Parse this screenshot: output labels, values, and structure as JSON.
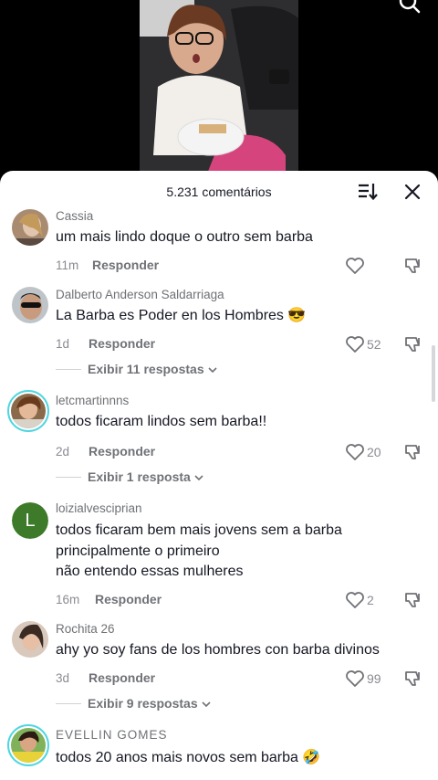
{
  "colors": {
    "accent_ring": "#4fd6e0",
    "text_primary": "#161823",
    "text_secondary": "#707277"
  },
  "video": {
    "icons": {
      "search": "search-icon"
    }
  },
  "header": {
    "count_label": "5.231 comentários",
    "icons": {
      "sort": "sort-icon",
      "close": "close-icon"
    }
  },
  "labels": {
    "reply": "Responder"
  },
  "comments": [
    {
      "username": "Cassia",
      "text": [
        "um mais lindo doque o outro sem barba"
      ],
      "time": "11m",
      "likes": "",
      "view_replies": ""
    },
    {
      "username": "Dalberto Anderson Saldarriaga",
      "text": [
        "La Barba es Poder en los Hombres 😎"
      ],
      "time": "1d",
      "likes": "52",
      "view_replies": "Exibir 11 respostas"
    },
    {
      "username": "letcmartinnns",
      "text": [
        "todos ficaram lindos sem barba!!"
      ],
      "time": "2d",
      "likes": "20",
      "view_replies": "Exibir 1 resposta"
    },
    {
      "username": "loizialvesciprian",
      "avatar_letter": "L",
      "text": [
        "todos ficaram bem mais jovens sem a barba",
        "principalmente o primeiro",
        "não entendo essas mulheres"
      ],
      "time": "16m",
      "likes": "2",
      "view_replies": ""
    },
    {
      "username": "Rochita 26",
      "text": [
        "ahy yo soy fans de los hombres con barba divinos"
      ],
      "time": "3d",
      "likes": "99",
      "view_replies": "Exibir 9 respostas"
    },
    {
      "username": "EVELLIN GOMES",
      "text": [
        "todos 20 anos mais novos sem barba 🤣"
      ],
      "time": "",
      "likes": "",
      "view_replies": ""
    }
  ]
}
